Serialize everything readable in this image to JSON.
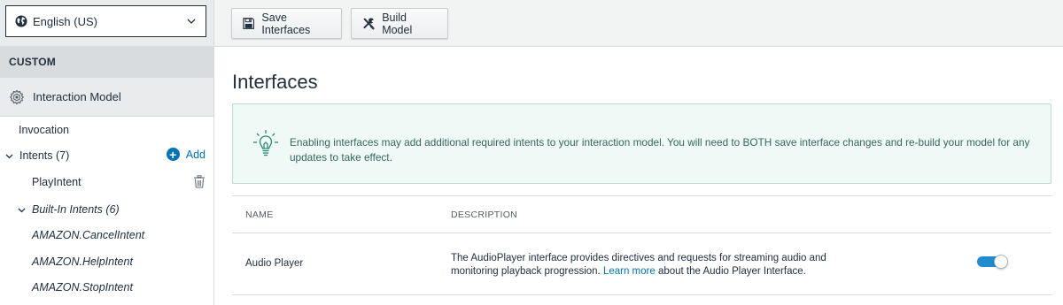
{
  "sidebar": {
    "locale": {
      "value": "English (US)",
      "icon": "globe-icon"
    },
    "section_title": "CUSTOM",
    "interaction_model": {
      "label": "Interaction Model",
      "icon": "gear-icon"
    },
    "invocation": "Invocation",
    "intents": {
      "label": "Intents (7)",
      "add_label": "Add",
      "add_icon": "plus-circle-icon"
    },
    "play_intent": "PlayIntent",
    "builtin_group": "Built-In Intents (6)",
    "builtin_items": [
      "AMAZON.CancelIntent",
      "AMAZON.HelpIntent",
      "AMAZON.StopIntent"
    ]
  },
  "toolbar": {
    "save_label": "Save Interfaces",
    "build_label": "Build Model"
  },
  "main": {
    "title": "Interfaces",
    "info_message": "Enabling interfaces may add additional required intents to your interaction model. You will need to BOTH save interface changes and re-build your model for any updates to take effect.",
    "table": {
      "headers": {
        "name": "NAME",
        "description": "DESCRIPTION"
      },
      "rows": [
        {
          "name": "Audio Player",
          "desc_before": "The AudioPlayer interface provides directives and requests for streaming audio and monitoring playback progression. ",
          "desc_link": "Learn more",
          "desc_after": " about the Audio Player Interface.",
          "enabled": true
        }
      ]
    }
  },
  "colors": {
    "accent": "#0073bb",
    "toggle_on": "#1e8ccf",
    "info_bg": "#eff9f6",
    "info_text": "#36675d"
  }
}
